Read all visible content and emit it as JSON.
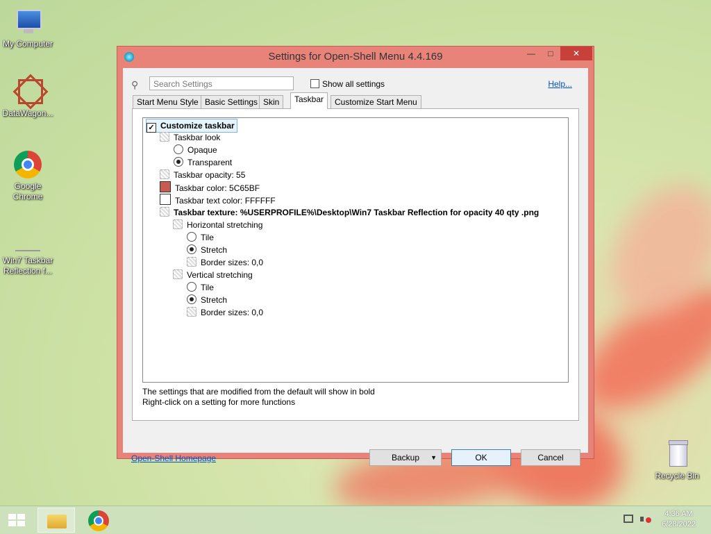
{
  "desktop": {
    "icons": [
      {
        "label": "My Computer"
      },
      {
        "label": "DataWagon..."
      },
      {
        "label": "Google Chrome"
      },
      {
        "label": "Win7 Taskbar Reflection f..."
      },
      {
        "label": "Recycle Bin"
      }
    ]
  },
  "window": {
    "title": "Settings for Open-Shell Menu 4.4.169",
    "minimize_glyph": "—",
    "maximize_glyph": "□",
    "close_glyph": "✕"
  },
  "search": {
    "placeholder": "Search Settings",
    "icon": "magnifier-icon"
  },
  "show_all": {
    "label": "Show all settings",
    "checked": false
  },
  "help_link": "Help...",
  "tabs": [
    {
      "label": "Start Menu Style"
    },
    {
      "label": "Basic Settings"
    },
    {
      "label": "Skin"
    },
    {
      "label": "Taskbar",
      "active": true
    },
    {
      "label": "Customize Start Menu"
    }
  ],
  "tree": {
    "customize_taskbar": "Customize taskbar",
    "taskbar_look": "Taskbar look",
    "opaque": "Opaque",
    "transparent": "Transparent",
    "opacity": "Taskbar opacity: 55",
    "color": "Taskbar color: 5C65BF",
    "text_color": "Taskbar text color: FFFFFF",
    "texture": "Taskbar texture: %USERPROFILE%\\Desktop\\Win7 Taskbar Reflection for opacity 40 qty .png",
    "h_stretch": "Horizontal stretching",
    "h_tile": "Tile",
    "h_stretch_opt": "Stretch",
    "h_border": "Border sizes: 0,0",
    "v_stretch": "Vertical stretching",
    "v_tile": "Tile",
    "v_stretch_opt": "Stretch",
    "v_border": "Border sizes: 0,0",
    "color_swatch": "#c65b52",
    "text_color_swatch": "#ffffff"
  },
  "hints": {
    "line1": "The settings that are modified from the default will show in bold",
    "line2": "Right-click on a setting for more functions"
  },
  "footer": {
    "homepage": "Open-Shell Homepage",
    "backup": "Backup",
    "ok": "OK",
    "cancel": "Cancel"
  },
  "taskbar": {
    "time": "4:36 AM",
    "date": "6/28/2022"
  },
  "colors": {
    "window_frame": "#e8837a",
    "accent_link": "#0050c8"
  }
}
